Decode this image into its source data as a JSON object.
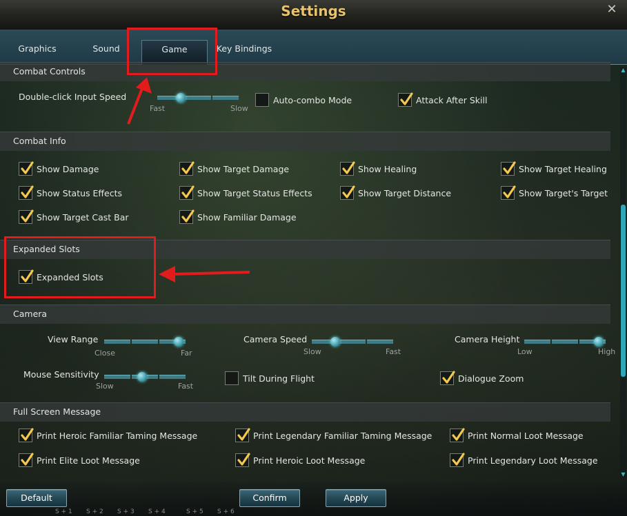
{
  "window": {
    "title": "Settings"
  },
  "tabs": [
    {
      "label": "Graphics"
    },
    {
      "label": "Sound"
    },
    {
      "label": "Game",
      "active": true
    },
    {
      "label": "Key Bindings"
    }
  ],
  "combat_controls": {
    "header": "Combat Controls",
    "double_click": {
      "label": "Double-click Input Speed",
      "min_label": "Fast",
      "max_label": "Slow",
      "level": 0.25
    },
    "auto_combo": {
      "label": "Auto-combo Mode",
      "checked": false
    },
    "attack_after_skill": {
      "label": "Attack After Skill",
      "checked": true
    }
  },
  "combat_info": {
    "header": "Combat Info",
    "items": [
      {
        "label": "Show Damage",
        "checked": true
      },
      {
        "label": "Show Target Damage",
        "checked": true
      },
      {
        "label": "Show Healing",
        "checked": true
      },
      {
        "label": "Show Target Healing",
        "checked": true
      },
      {
        "label": "Show Status Effects",
        "checked": true
      },
      {
        "label": "Show Target Status Effects",
        "checked": true
      },
      {
        "label": "Show Target Distance",
        "checked": true
      },
      {
        "label": "Show Target's Target",
        "checked": true
      },
      {
        "label": "Show Target Cast Bar",
        "checked": true
      },
      {
        "label": "Show Familiar Damage",
        "checked": true
      }
    ]
  },
  "expanded_slots": {
    "header": "Expanded Slots",
    "item": {
      "label": "Expanded Slots",
      "checked": true
    }
  },
  "camera": {
    "header": "Camera",
    "view_range": {
      "label": "View Range",
      "min_label": "Close",
      "max_label": "Far",
      "level": 0.95
    },
    "camera_speed": {
      "label": "Camera Speed",
      "min_label": "Slow",
      "max_label": "Fast",
      "level": 0.25
    },
    "camera_height": {
      "label": "Camera Height",
      "min_label": "Low",
      "max_label": "High",
      "level": 0.95
    },
    "mouse_sensitivity": {
      "label": "Mouse Sensitivity",
      "min_label": "Slow",
      "max_label": "Fast",
      "level": 0.45
    },
    "tilt_during_flight": {
      "label": "Tilt During Flight",
      "checked": false
    },
    "dialogue_zoom": {
      "label": "Dialogue Zoom",
      "checked": true
    }
  },
  "full_screen_message": {
    "header": "Full Screen Message",
    "items": [
      {
        "label": "Print Heroic Familiar Taming Message",
        "checked": true
      },
      {
        "label": "Print Legendary Familiar Taming Message",
        "checked": true
      },
      {
        "label": "Print Normal Loot Message",
        "checked": true
      },
      {
        "label": "Print Elite Loot Message",
        "checked": true
      },
      {
        "label": "Print Heroic Loot Message",
        "checked": true
      },
      {
        "label": "Print Legendary Loot Message",
        "checked": true
      }
    ]
  },
  "buttons": {
    "default": "Default",
    "confirm": "Confirm",
    "apply": "Apply"
  },
  "hotbar": [
    "S + 1",
    "S + 2",
    "S + 3",
    "S + 4",
    "S + 5",
    "S + 6"
  ],
  "colors": {
    "title": "#e8c36a",
    "accent": "#2fa7b6",
    "check": "#f2c94c",
    "annotation": "#e21c1c"
  }
}
